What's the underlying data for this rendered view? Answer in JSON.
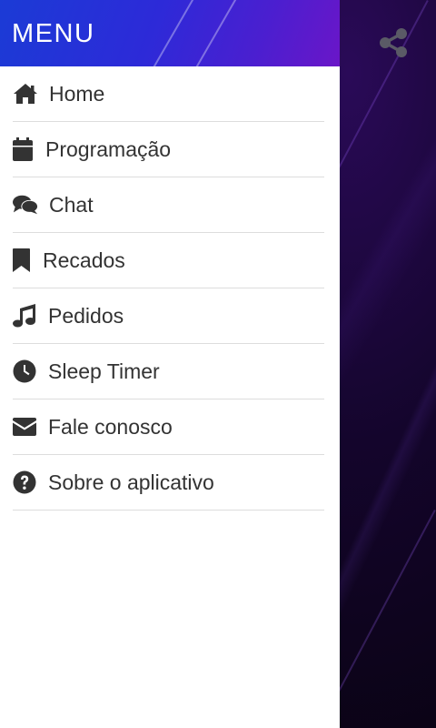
{
  "drawer": {
    "title": "MENU",
    "items": [
      {
        "label": "Home",
        "icon": "home-icon"
      },
      {
        "label": "Programação",
        "icon": "calendar-icon"
      },
      {
        "label": "Chat",
        "icon": "chat-icon"
      },
      {
        "label": "Recados",
        "icon": "bookmark-icon"
      },
      {
        "label": "Pedidos",
        "icon": "music-note-icon"
      },
      {
        "label": "Sleep Timer",
        "icon": "clock-icon"
      },
      {
        "label": "Fale conosco",
        "icon": "envelope-icon"
      },
      {
        "label": "Sobre o aplicativo",
        "icon": "question-circle-icon"
      }
    ]
  },
  "toolbar": {
    "share_icon": "share-icon"
  },
  "colors": {
    "header_gradient_start": "#1b3bd6",
    "header_gradient_end": "#6a16c8",
    "menu_text": "#333333",
    "divider": "#dddddd",
    "background_dark": "#0d0418",
    "share_icon": "#5a5a66"
  }
}
